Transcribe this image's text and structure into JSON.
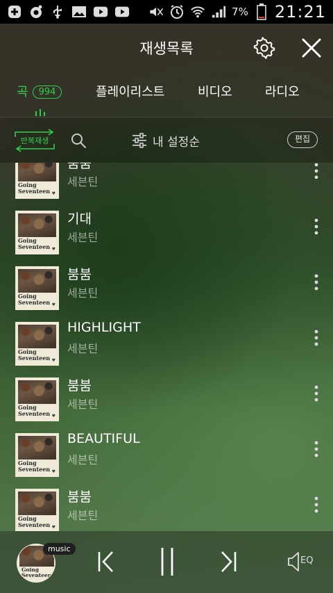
{
  "status_bar": {
    "battery_percent": "7%",
    "time": "21:21"
  },
  "header": {
    "title": "재생목록"
  },
  "tabs": [
    {
      "label": "곡",
      "count": "994",
      "active": true
    },
    {
      "label": "플레이리스트"
    },
    {
      "label": "비디오"
    },
    {
      "label": "라디오"
    }
  ],
  "toolbar": {
    "repeat_label": "반복재생",
    "sort_label": "내 설정순",
    "edit_label": "편집"
  },
  "album_art": {
    "title": "Going Seventeen"
  },
  "songs": [
    {
      "title": "붐붐",
      "artist": "세븐틴"
    },
    {
      "title": "기대",
      "artist": "세븐틴"
    },
    {
      "title": "붐붐",
      "artist": "세븐틴"
    },
    {
      "title": "HIGHLIGHT",
      "artist": "세븐틴"
    },
    {
      "title": "붐붐",
      "artist": "세븐틴"
    },
    {
      "title": "BEAUTIFUL",
      "artist": "세븐틴"
    },
    {
      "title": "붐붐",
      "artist": "세븐틴"
    }
  ],
  "player": {
    "badge": "music",
    "eq_label": "EQ"
  },
  "colors": {
    "accent": "#2bd147"
  }
}
